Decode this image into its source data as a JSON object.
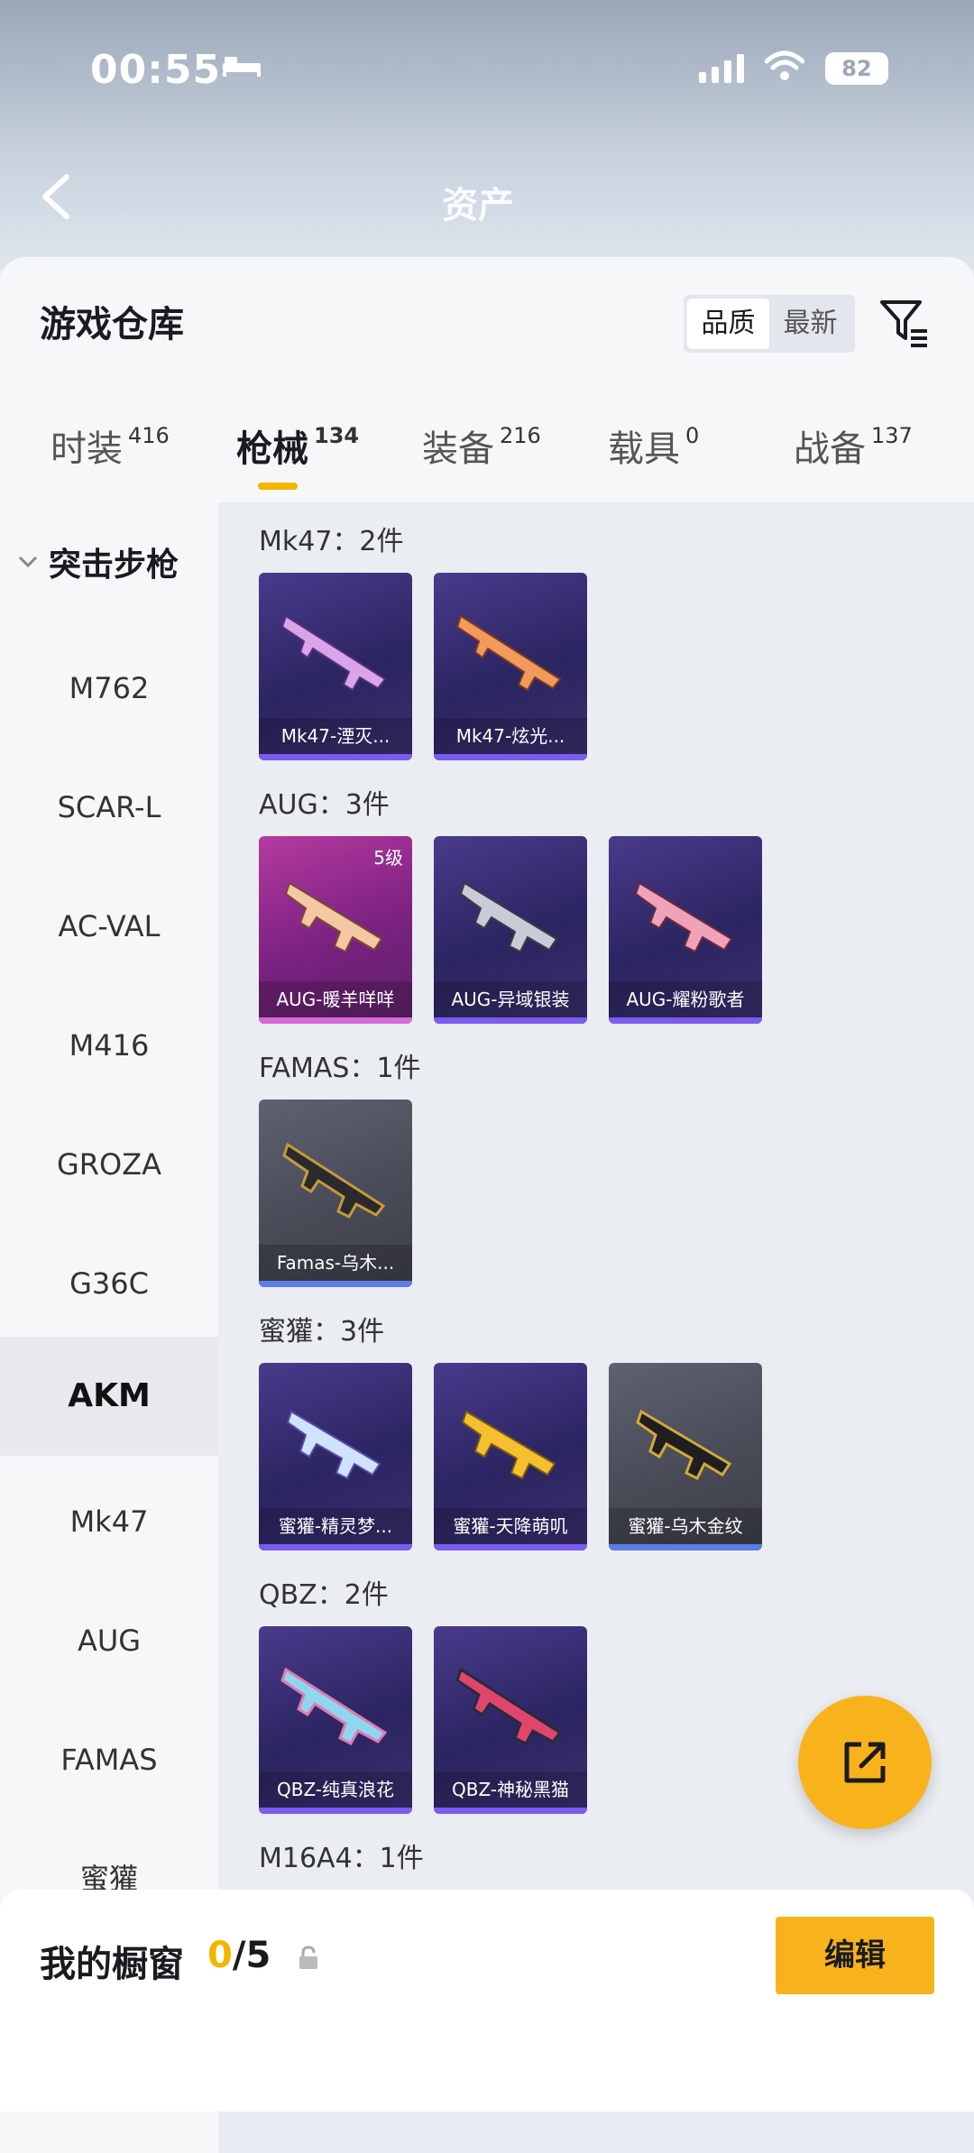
{
  "status_bar": {
    "time": "00:55",
    "battery": "82"
  },
  "screen_title": "资产",
  "header": {
    "title": "游戏仓库",
    "sort_options": [
      "品质",
      "最新"
    ]
  },
  "tabs": [
    {
      "label": "时装",
      "count": "416"
    },
    {
      "label": "枪械",
      "count": "134"
    },
    {
      "label": "装备",
      "count": "216"
    },
    {
      "label": "载具",
      "count": "0"
    },
    {
      "label": "战备",
      "count": "137"
    }
  ],
  "sidebar": {
    "group": "突击步枪",
    "items": [
      "M762",
      "SCAR-L",
      "AC-VAL",
      "M416",
      "GROZA",
      "G36C",
      "AKM",
      "Mk47",
      "AUG",
      "FAMAS",
      "蜜獾"
    ],
    "selected": "AKM"
  },
  "sections": [
    {
      "title": "Mk47：2件",
      "cards": [
        {
          "name": "Mk47-湮灭...",
          "style": "purple"
        },
        {
          "name": "Mk47-炫光...",
          "style": "purple"
        }
      ]
    },
    {
      "title": "AUG：3件",
      "cards": [
        {
          "name": "AUG-暖羊咩咩",
          "style": "pink",
          "level": "5级"
        },
        {
          "name": "AUG-异域银装",
          "style": "purple"
        },
        {
          "name": "AUG-耀粉歌者",
          "style": "purple"
        }
      ]
    },
    {
      "title": "FAMAS：1件",
      "cards": [
        {
          "name": "Famas-乌木...",
          "style": "grey"
        }
      ]
    },
    {
      "title": "蜜獾：3件",
      "cards": [
        {
          "name": "蜜獾-精灵梦...",
          "style": "purple"
        },
        {
          "name": "蜜獾-天降萌叽",
          "style": "purple"
        },
        {
          "name": "蜜獾-乌木金纹",
          "style": "grey"
        }
      ]
    },
    {
      "title": "QBZ：2件",
      "cards": [
        {
          "name": "QBZ-纯真浪花",
          "style": "purple"
        },
        {
          "name": "QBZ-神秘黑猫",
          "style": "purple"
        }
      ]
    },
    {
      "title": "M16A4：1件",
      "cards": []
    }
  ],
  "bottom_bar": {
    "label": "我的橱窗",
    "count_current": "0",
    "count_total": "/5",
    "edit_label": "编辑"
  },
  "colors": {
    "accent": "#f8b31c",
    "card_purple": "#2b2561",
    "card_pink": "#7a2181",
    "card_grey": "#474955"
  },
  "icons": [
    "back-arrow-icon",
    "filter-icon",
    "chevron-down-icon",
    "lock-icon",
    "share-icon",
    "wifi-icon",
    "bed-icon"
  ]
}
